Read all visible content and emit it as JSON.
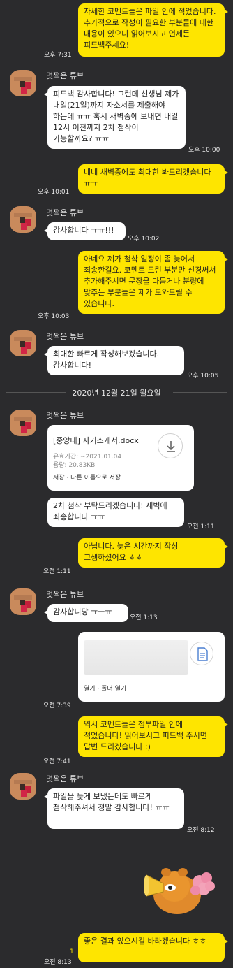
{
  "sender_name": "멋쩍은 튜브",
  "messages": {
    "m1": {
      "text": "자세한 코멘트들은 파일 안에 적었습니다. 추가적으로 작성이 필요한 부분들에 대한 내용이 있으니 읽어보시고 언제든 피드백주세요!",
      "time": "오후 7:31"
    },
    "m2": {
      "text": "피드백 감사합니다! 그런데 선생님 제가 내일(21일)까지 자소서를 제출해야 하는데 ㅠㅠ 혹시 새벽중에 보내면 내일 12시 이전까지 2차 첨삭이 가능할까요? ㅠㅠ",
      "time": "오후 10:00"
    },
    "m3": {
      "text": "네네 새벽중에도 최대한 봐드리겠습니다 ㅠㅠ",
      "time": "오후 10:01"
    },
    "m4": {
      "text": "감사합니다 ㅠㅠ!!!",
      "time": "오후 10:02"
    },
    "m5": {
      "text": "아네요 제가 첨삭 일정이 좀 늦어서 죄송한걸요. 코멘트 드린 부분만 신경써서 추가해주시면 문장을 다듬거나 분량에 맞추는 부분들은 제가 도와드릴 수 있습니다.",
      "time": "오후 10:03"
    },
    "m6": {
      "text": "최대한 빠르게 작성해보겠습니다. 감사합니다!",
      "time": "오후 10:05"
    },
    "m8": {
      "text": "2차 첨삭 부탁드리겠습니다! 새벽에 죄송합니다 ㅠㅠ",
      "time": "오전 1:11"
    },
    "m9": {
      "text": "아닙니다. 늦은 시간까지 작성 고생하셨어요 ㅎㅎ",
      "time": "오전 1:11"
    },
    "m10": {
      "text": "감사합니당 ㅠㅡㅠ",
      "time": "오전 1:13"
    },
    "m12": {
      "text": "역시 코멘트들은 첨부파일 안에 적었습니다! 읽어보시고 피드백 주시면 답변 드리겠습니다 :)",
      "time": "오전 7:41"
    },
    "m13": {
      "text": "파일을 늦게 보냈는데도 빠르게 첨삭해주셔서 정말 감사합니다! ㅠㅠ",
      "time": "오전 8:12"
    },
    "m15": {
      "text": "좋은 결과 있으시길 바라겠습니다 ㅎㅎ",
      "time": "오전 8:13",
      "unread": "1"
    }
  },
  "date_divider": "2020년 12월 21일 월요일",
  "file_message": {
    "file_name": "[중앙대] 자기소개서.docx",
    "expiry": "유효기간: ~2021.01.04",
    "size": "용량: 20.83KB",
    "actions": "저장 · 다른 이름으로 저장",
    "icon": "download-icon"
  },
  "file_message_2": {
    "time": "오전 7:39",
    "actions": "열기 · 폴더 열기",
    "icon": "document-icon"
  },
  "sticker": "ryan-sticker",
  "colors": {
    "background": "#2b2b2d",
    "my_bubble": "#fee500",
    "their_bubble": "#ffffff"
  }
}
